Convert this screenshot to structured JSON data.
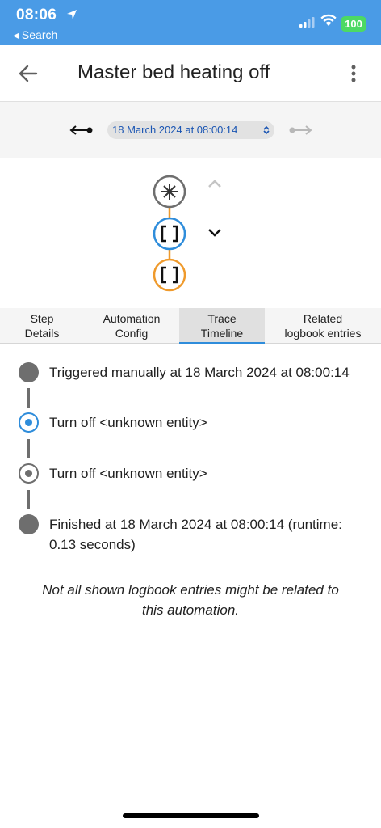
{
  "status_bar": {
    "time": "08:06",
    "back_app": "◂ Search",
    "battery": "100"
  },
  "header": {
    "title": "Master bed heating off"
  },
  "trace_selector": {
    "selected": "18 March 2024 at 08:00:14"
  },
  "tabs": [
    {
      "line1": "Step",
      "line2": "Details"
    },
    {
      "line1": "Automation",
      "line2": "Config"
    },
    {
      "line1": "Trace",
      "line2": "Timeline"
    },
    {
      "line1": "Related",
      "line2": "logbook entries"
    }
  ],
  "timeline": [
    {
      "text": "Triggered manually at 18 March 2024 at 08:00:14",
      "kind": "trigger"
    },
    {
      "text": "Turn off <unknown entity>",
      "kind": "action-active"
    },
    {
      "text": "Turn off <unknown entity>",
      "kind": "action"
    },
    {
      "line1": "Finished at 18 March 2024 at 08:00:14 (runtime:",
      "line2": "0.13 seconds)",
      "kind": "finish"
    }
  ],
  "footnote": {
    "line1": "Not all shown logbook entries might be related to",
    "line2": "this automation."
  },
  "colors": {
    "status_bar": "#4a9be6",
    "accent_blue": "#2f8ddb",
    "accent_orange": "#ef9a2c",
    "link_blue": "#1a55b3",
    "timeline_grey": "#6e6e6e"
  }
}
